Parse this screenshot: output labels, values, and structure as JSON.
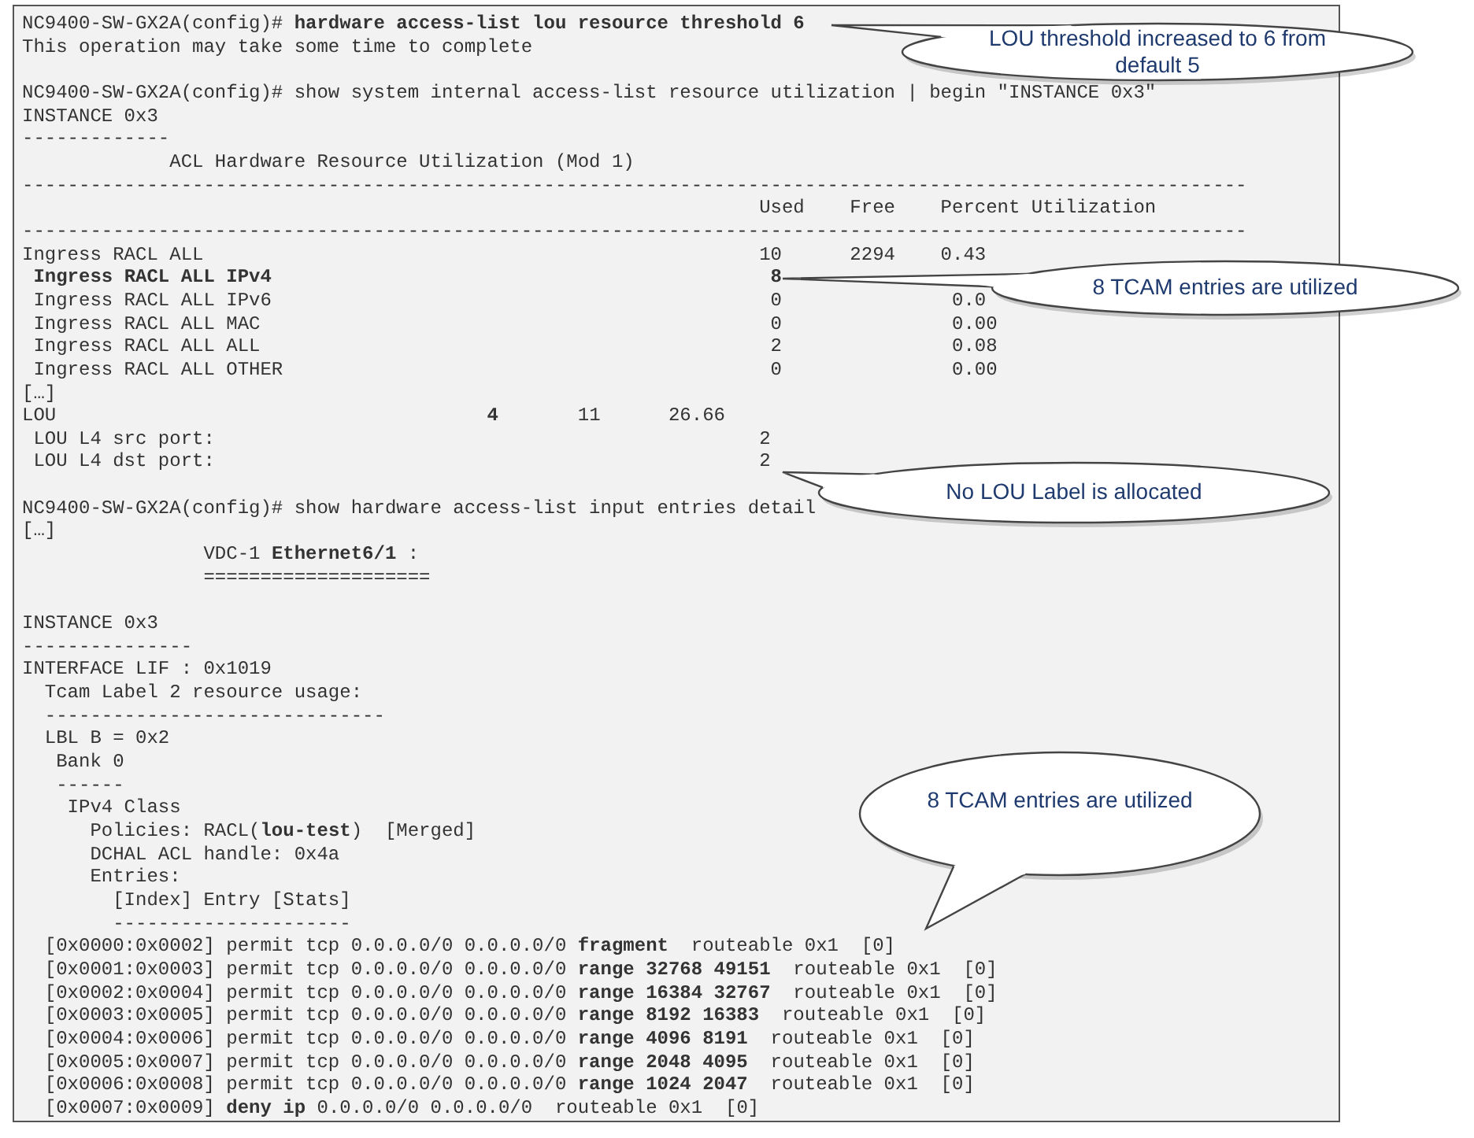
{
  "terminal": {
    "blocks": [
      {
        "lines": [
          "NC9400-SW-GX2A(config)# **hardware access-list lou resource threshold 6**",
          "This operation may take some time to complete"
        ]
      },
      {
        "lines": [
          "NC9400-SW-GX2A(config)# show system internal access-list resource utilization | begin \"INSTANCE 0x3\"",
          "INSTANCE 0x3",
          "-------------",
          "             ACL Hardware Resource Utilization (Mod 1)",
          "------------------------------------------------------------------------------------------------------------",
          "                                                                 Used    Free    Percent Utilization",
          "------------------------------------------------------------------------------------------------------------",
          "Ingress RACL ALL                                                 10      2294    0.43",
          " **Ingress RACL ALL IPv4**                                            **8**",
          " Ingress RACL ALL IPv6                                            0               0.0",
          " Ingress RACL ALL MAC                                             0               0.00",
          " Ingress RACL ALL ALL                                             2               0.08",
          " Ingress RACL ALL OTHER                                           0               0.00",
          "[…]",
          "LOU                                      **4**       11      26.66",
          " LOU L4 src port:                                                2",
          " LOU L4 dst port:                                                2"
        ]
      },
      {
        "lines": [
          "NC9400-SW-GX2A(config)# show hardware access-list input entries detail",
          "[…]",
          "                VDC-1 **Ethernet6/1** :",
          "                ===================="
        ]
      },
      {
        "lines": [
          "INSTANCE 0x3",
          "---------------",
          "INTERFACE LIF : 0x1019",
          "  Tcam Label 2 resource usage:",
          "  ------------------------------",
          "  LBL B = 0x2",
          "   Bank 0",
          "   ------",
          "    IPv4 Class",
          "      Policies: RACL(**lou-test**)  [Merged]",
          "      DCHAL ACL handle: 0x4a",
          "      Entries:",
          "        [Index] Entry [Stats]",
          "        ---------------------",
          "  [0x0000:0x0002] permit tcp 0.0.0.0/0 0.0.0.0/0 **fragment**  routeable 0x1  [0]",
          "  [0x0001:0x0003] permit tcp 0.0.0.0/0 0.0.0.0/0 **range 32768 49151**  routeable 0x1  [0]",
          "  [0x0002:0x0004] permit tcp 0.0.0.0/0 0.0.0.0/0 **range 16384 32767**  routeable 0x1  [0]",
          "  [0x0003:0x0005] permit tcp 0.0.0.0/0 0.0.0.0/0 **range 8192 16383**  routeable 0x1  [0]",
          "  [0x0004:0x0006] permit tcp 0.0.0.0/0 0.0.0.0/0 **range 4096 8191**  routeable 0x1  [0]",
          "  [0x0005:0x0007] permit tcp 0.0.0.0/0 0.0.0.0/0 **range 2048 4095**  routeable 0x1  [0]",
          "  [0x0006:0x0008] permit tcp 0.0.0.0/0 0.0.0.0/0 **range 1024 2047**  routeable 0x1  [0]",
          "  [0x0007:0x0009] **deny ip** 0.0.0.0/0 0.0.0.0/0  routeable 0x1  [0]"
        ]
      }
    ]
  },
  "callouts": [
    {
      "text": "LOU threshold increased to 6 from default 5"
    },
    {
      "text": "8 TCAM entries are utilized"
    },
    {
      "text": "No LOU Label is allocated"
    },
    {
      "text": "8 TCAM entries are utilized"
    }
  ]
}
